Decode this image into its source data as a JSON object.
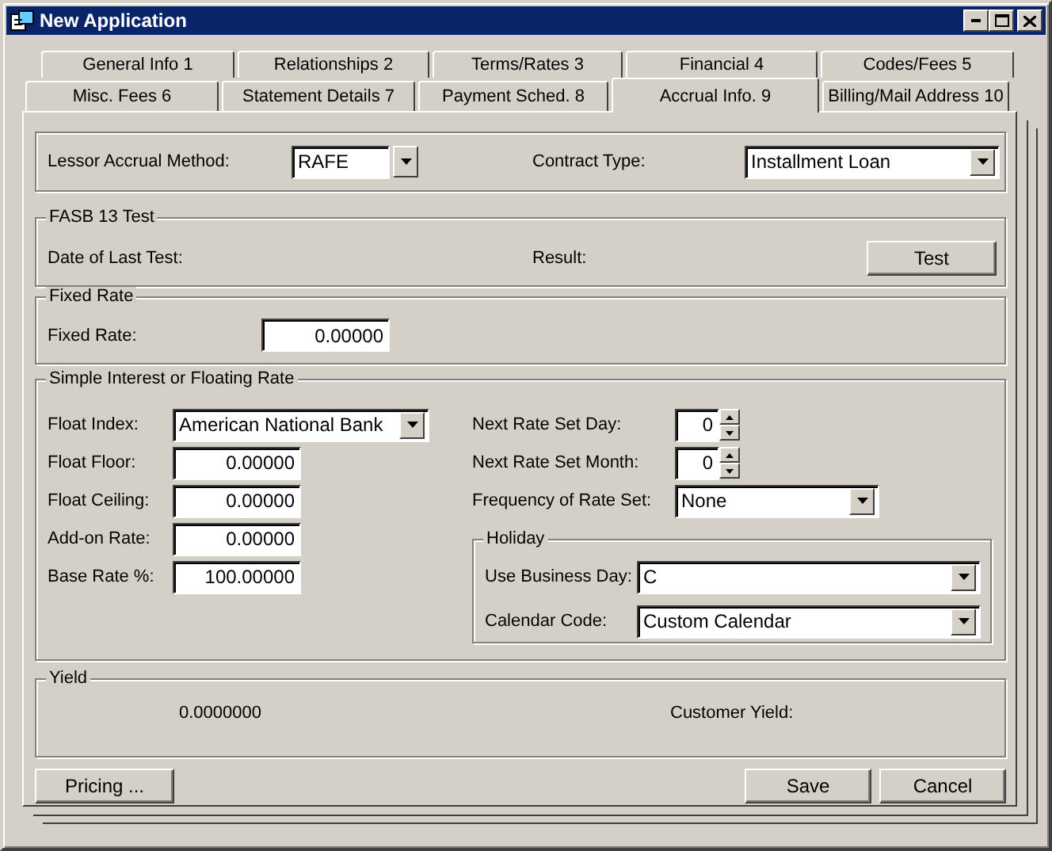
{
  "window": {
    "title": "New Application"
  },
  "tab_rows": [
    [
      {
        "label": "General Info 1",
        "selected": false
      },
      {
        "label": "Relationships 2",
        "selected": false
      },
      {
        "label": "Terms/Rates 3",
        "selected": false
      },
      {
        "label": "Financial 4",
        "selected": false
      },
      {
        "label": "Codes/Fees 5",
        "selected": false
      }
    ],
    [
      {
        "label": "Misc. Fees 6",
        "selected": false
      },
      {
        "label": "Statement Details 7",
        "selected": false
      },
      {
        "label": "Payment Sched. 8",
        "selected": false
      },
      {
        "label": "Accrual Info. 9",
        "selected": true
      },
      {
        "label": "Billing/Mail Address 10",
        "selected": false
      }
    ]
  ],
  "accrual": {
    "method_label": "Lessor Accrual Method:",
    "method_value": "RAFE",
    "contract_label": "Contract Type:",
    "contract_value": "Installment Loan"
  },
  "fasb_test": {
    "title": "FASB 13 Test",
    "date_label": "Date of Last Test:",
    "result_label": "Result:",
    "button": "Test"
  },
  "fixed_rate": {
    "title": "Fixed Rate",
    "label": "Fixed Rate:",
    "value": "0.00000"
  },
  "floating": {
    "title": "Simple Interest or Floating Rate",
    "left": [
      {
        "kind": "dropdown",
        "label": "Float Index:",
        "value": "American National Bank"
      },
      {
        "kind": "text",
        "label": "Float Floor:",
        "value": "0.00000"
      },
      {
        "kind": "text",
        "label": "Float Ceiling:",
        "value": "0.00000"
      },
      {
        "kind": "text",
        "label": "Add-on Rate:",
        "value": "0.00000"
      },
      {
        "kind": "text",
        "label": "Base Rate %:",
        "value": "100.00000"
      }
    ],
    "right": [
      {
        "kind": "spinner",
        "label": "Next Rate Set Day:",
        "value": "0"
      },
      {
        "kind": "spinner",
        "label": "Next Rate Set Month:",
        "value": "0"
      },
      {
        "kind": "dropdown",
        "label": "Frequency of Rate Set:",
        "value": "None"
      }
    ],
    "holiday": {
      "title": "Holiday",
      "fields": [
        {
          "label": "Use Business Day:",
          "value": "C"
        },
        {
          "label": "Calendar Code:",
          "value": "Custom Calendar"
        }
      ]
    }
  },
  "yield": {
    "title": "Yield",
    "value": "0.0000000",
    "customer_label": "Customer Yield:"
  },
  "buttons": {
    "left": [
      "Pricing ..."
    ],
    "right": [
      "Save",
      "Cancel"
    ]
  }
}
